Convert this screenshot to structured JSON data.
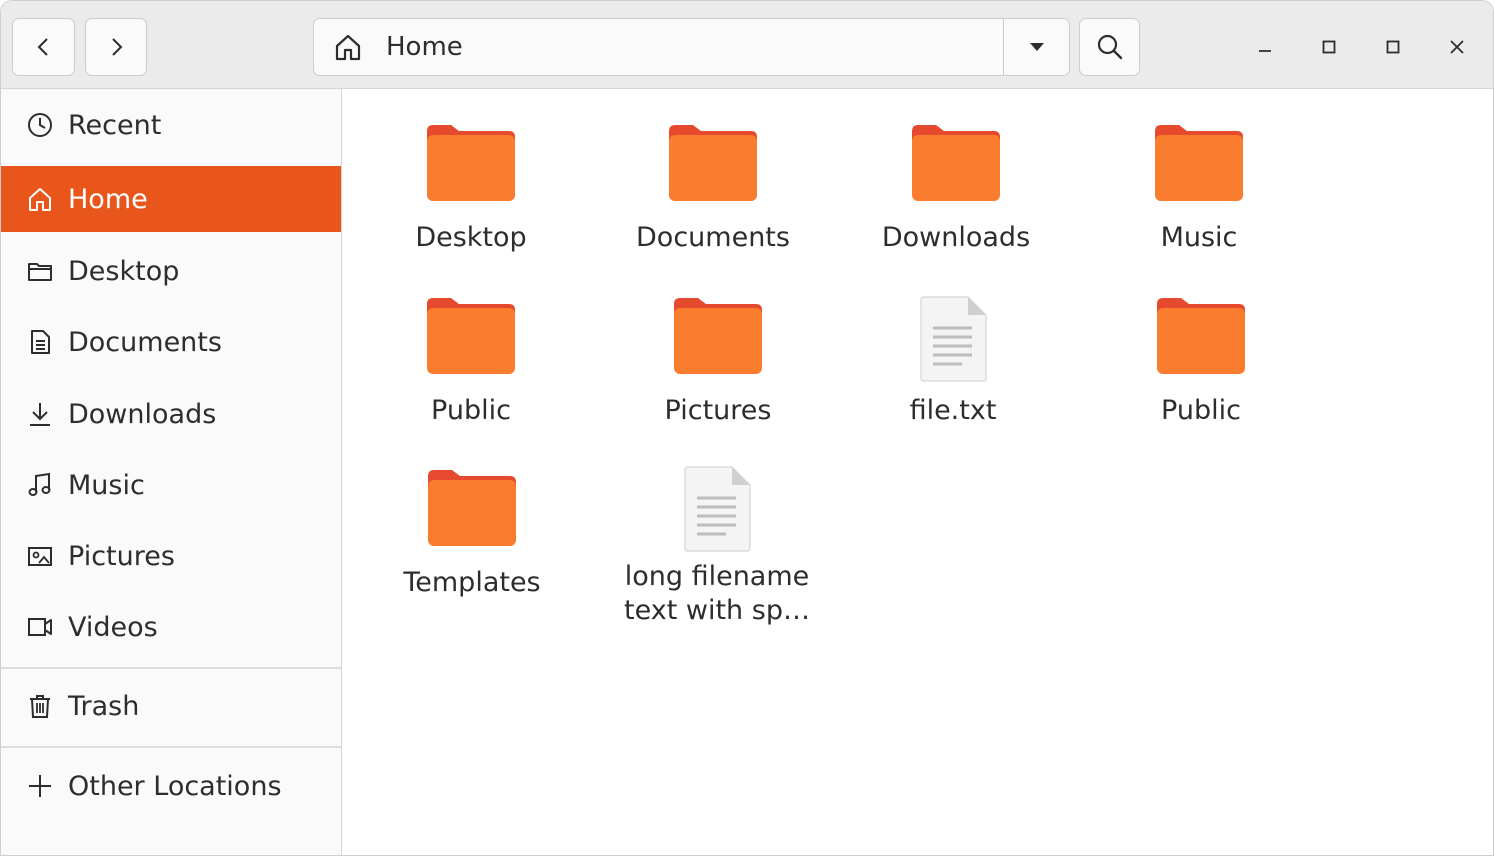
{
  "colors": {
    "accent": "#e9561b",
    "folder_body": "#f97c2f",
    "folder_tab": "#e64a2e",
    "headerbar_bg": "#ebebeb",
    "sidebar_bg": "#fafafa"
  },
  "header": {
    "back_icon": "chevron-left-icon",
    "forward_icon": "chevron-right-icon",
    "path": {
      "icon": "home-icon",
      "label": "Home",
      "dropdown_icon": "triangle-down-icon"
    },
    "search_icon": "search-icon",
    "window_controls": [
      "minimize-icon",
      "restore-icon",
      "maximize-icon",
      "close-icon"
    ]
  },
  "sidebar": {
    "items": [
      {
        "label": "Recent",
        "icon": "clock-icon",
        "active": false
      },
      {
        "label": "Home",
        "icon": "home-icon",
        "active": true
      },
      {
        "label": "Desktop",
        "icon": "folder-icon",
        "active": false
      },
      {
        "label": "Documents",
        "icon": "document-icon",
        "active": false
      },
      {
        "label": "Downloads",
        "icon": "download-icon",
        "active": false
      },
      {
        "label": "Music",
        "icon": "music-note-icon",
        "active": false
      },
      {
        "label": "Pictures",
        "icon": "image-icon",
        "active": false
      },
      {
        "label": "Videos",
        "icon": "video-camera-icon",
        "active": false
      },
      {
        "label": "Trash",
        "icon": "trash-icon",
        "active": false
      },
      {
        "label": "Other Locations",
        "icon": "plus-icon",
        "active": false
      }
    ]
  },
  "files": [
    {
      "name": "Desktop",
      "type": "folder"
    },
    {
      "name": "Documents",
      "type": "folder"
    },
    {
      "name": "Downloads",
      "type": "folder"
    },
    {
      "name": "Music",
      "type": "folder"
    },
    {
      "name": "Public",
      "type": "folder"
    },
    {
      "name": "Pictures",
      "type": "folder"
    },
    {
      "name": "file.txt",
      "type": "text"
    },
    {
      "name": "Public",
      "type": "folder"
    },
    {
      "name": "Templates",
      "type": "folder"
    },
    {
      "name": "long filename text with sp…",
      "type": "text"
    }
  ]
}
